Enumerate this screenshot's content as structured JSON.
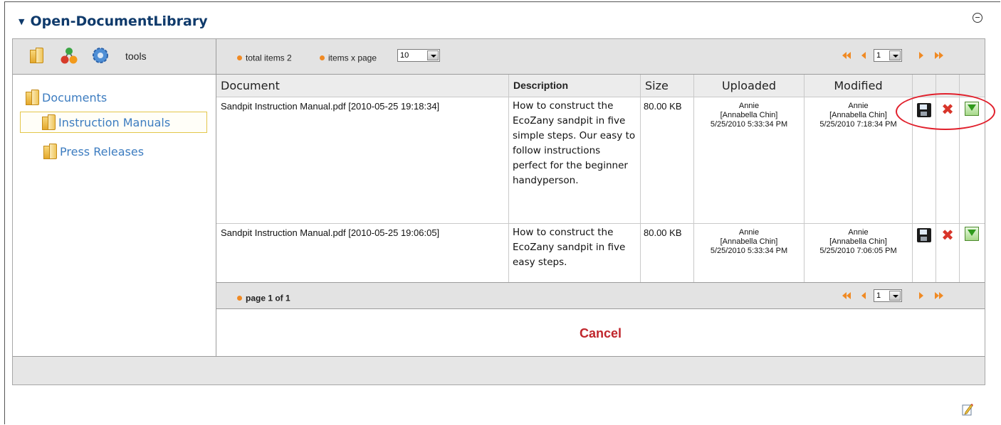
{
  "module": {
    "title": "Open-DocumentLibrary"
  },
  "toolbar": {
    "tools_label": "tools"
  },
  "tree": {
    "items": [
      {
        "label": "Documents"
      },
      {
        "label": "Instruction Manuals"
      },
      {
        "label": "Press Releases"
      }
    ]
  },
  "top_bar": {
    "total_items_label": "total items 2",
    "items_per_page_label": "items x page",
    "items_per_page_value": "10",
    "page_select_value": "1"
  },
  "table": {
    "headers": {
      "document": "Document",
      "description": "Description",
      "size": "Size",
      "uploaded": "Uploaded",
      "modified": "Modified"
    },
    "rows": [
      {
        "document": "Sandpit Instruction Manual.pdf [2010-05-25 19:18:34]",
        "description": "How to construct the EcoZany sandpit in five simple steps. Our easy to follow instructions perfect for the beginner handyperson.",
        "size": "80.00 KB",
        "uploaded": {
          "user": "Annie",
          "name": "[Annabella Chin]",
          "date": "5/25/2010 5:33:34 PM"
        },
        "modified": {
          "user": "Annie",
          "name": "[Annabella Chin]",
          "date": "5/25/2010 7:18:34 PM"
        }
      },
      {
        "document": "Sandpit Instruction Manual.pdf [2010-05-25 19:06:05]",
        "description": "How to construct the EcoZany sandpit in five easy steps.",
        "size": "80.00 KB",
        "uploaded": {
          "user": "Annie",
          "name": "[Annabella Chin]",
          "date": "5/25/2010 5:33:34 PM"
        },
        "modified": {
          "user": "Annie",
          "name": "[Annabella Chin]",
          "date": "5/25/2010 7:06:05 PM"
        }
      }
    ]
  },
  "bottom_bar": {
    "page_label": "page 1 of 1",
    "page_select_value": "1"
  },
  "actions": {
    "cancel_label": "Cancel"
  },
  "icons": {
    "save": "save-floppy-icon",
    "delete": "delete-x-icon",
    "download": "download-icon",
    "first": "first-page-icon",
    "prev": "previous-page-icon",
    "next": "next-page-icon",
    "last": "last-page-icon",
    "edit": "edit-pencil-icon"
  },
  "colors": {
    "title": "#0f3a6b",
    "link": "#3c7cc0",
    "accent_orange": "#f08a24",
    "cancel": "#c0262c",
    "highlight_circle": "#e1202c"
  }
}
